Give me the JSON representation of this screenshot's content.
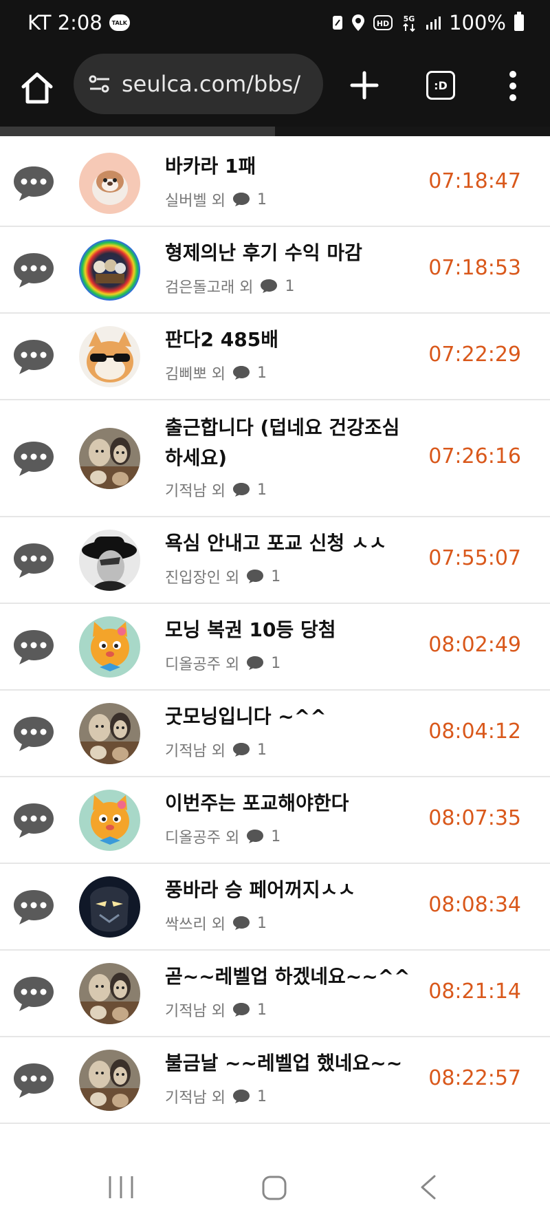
{
  "status_bar": {
    "carrier_time": "KT 2:08",
    "talk_badge": "TALK",
    "battery_text": "100%",
    "icons": [
      "nfc-icon",
      "location-icon",
      "hd-icon",
      "5g-icon",
      "signal-icon",
      "battery-icon"
    ]
  },
  "browser": {
    "url": "seulca.com/bbs/",
    "tab_label": ":D"
  },
  "posts": [
    {
      "title": "바카라 1패",
      "author": "실버벨 외",
      "comments": "1",
      "time": "07:18:47",
      "avatar": "otter"
    },
    {
      "title": "형제의난 후기 수익 마감",
      "author": "검은돌고래 외",
      "comments": "1",
      "time": "07:18:53",
      "avatar": "colorful"
    },
    {
      "title": "판다2 485배",
      "author": "김삐뽀 외",
      "comments": "1",
      "time": "07:22:29",
      "avatar": "cat-sunglasses"
    },
    {
      "title": "출근합니다 (덥네요 건강조심하세요)",
      "author": "기적남 외",
      "comments": "1",
      "time": "07:26:16",
      "avatar": "couple"
    },
    {
      "title": "욕심 안내고 포교 신청 ㅅㅅ",
      "author": "진입장인 외",
      "comments": "1",
      "time": "07:55:07",
      "avatar": "bw-hat"
    },
    {
      "title": "모닝 복권 10등 당첨",
      "author": "디올공주 외",
      "comments": "1",
      "time": "08:02:49",
      "avatar": "orange-cat"
    },
    {
      "title": "굿모닝입니다 ~^^",
      "author": "기적남 외",
      "comments": "1",
      "time": "08:04:12",
      "avatar": "couple"
    },
    {
      "title": "이번주는 포교해야한다",
      "author": "디올공주 외",
      "comments": "1",
      "time": "08:07:35",
      "avatar": "orange-cat"
    },
    {
      "title": "풍바라 승 페어꺼지ㅅㅅ",
      "author": "싹쓰리 외",
      "comments": "1",
      "time": "08:08:34",
      "avatar": "dark-mask"
    },
    {
      "title": "곧~~레벨업 하겠네요~~^^",
      "author": "기적남 외",
      "comments": "1",
      "time": "08:21:14",
      "avatar": "couple"
    },
    {
      "title": "불금날 ~~레벨업 했네요~~",
      "author": "기적남 외",
      "comments": "1",
      "time": "08:22:57",
      "avatar": "couple"
    }
  ],
  "colors": {
    "time": "#d9581b",
    "status_bg": "#131313",
    "url_pill": "#2e2e2e",
    "divider": "#e6e6e6",
    "bubble": "#5a5a5a"
  },
  "progress": 0.5
}
